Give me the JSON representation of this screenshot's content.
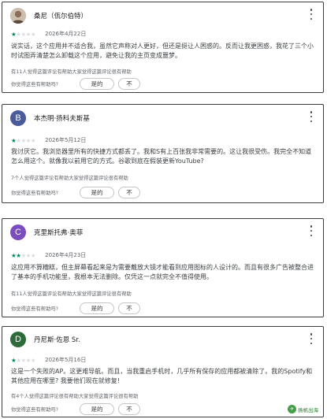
{
  "colors": {
    "star_filled": "#01875f",
    "star_empty": "#dadce0",
    "border": "#3c3c3c"
  },
  "reviews": [
    {
      "reviewer": "桑尼（佤尔伯特）",
      "avatar_icon": "profile-photo",
      "rating": 1,
      "max_rating": 5,
      "date": "2026年4月22日",
      "text": "说实话，这个应用并不适合我，虽然它声称对人更好，但还是挺让人困惑的。反而让我更困惑，我花了三个小时试图弄清楚怎么卸载这个应用，避免让我的主页变成噩梦。",
      "helpful_count": "有11人觉得这篇评论有帮助大家觉得这篇评论很有帮助",
      "helpful_question": "你觉得这些有帮助吗?",
      "yes_label": "是的",
      "no_label": "不"
    },
    {
      "reviewer": "本杰明·扬科夫斯基",
      "avatar_letter": "B",
      "avatar_color": "#4a5b9a",
      "rating": 1,
      "max_rating": 5,
      "date": "2026年5月12日",
      "text": "我讨厌它。我浏览器里所有的快捷方式都丢了。我和S有上百张我非常需要的。这让我很受伤。我完全不知道怎么用这个。就像我以前用它的方式。谷歌到底在假装更新YouTube?",
      "helpful_count": "7个人觉得这篇评论有帮助大家觉得这篇评论很有帮助",
      "helpful_question": "你觉得这些有帮助吗?",
      "yes_label": "是的",
      "no_label": "不"
    },
    {
      "reviewer": "克里斯托弗·奥菲",
      "avatar_letter": "C",
      "avatar_color": "#7c4dbf",
      "rating": 2,
      "max_rating": 5,
      "date": "2026年4月23日",
      "text": "这应用不算糟糕，但主屏幕看起来是为需要戴放大镜才能看到应用图标的人设计的。而且有很多广告被整合进了基本的手机功能里，我根本无法删除。仅凭这一点就完全不值得使用。",
      "helpful_count": "有11人觉得这篇评论有帮助大家觉得这篇评论很有帮助",
      "helpful_question": "你觉得这些有帮助吗?",
      "yes_label": "是的",
      "no_label": "不"
    },
    {
      "reviewer": "丹尼斯·佐恩 Sr.",
      "avatar_letter": "D",
      "avatar_color": "#2e6b3a",
      "rating": 1,
      "max_rating": 5,
      "date": "2026年5月16日",
      "text": "这是一个失败的AP。这更难导航。而且，当我重启手机时，几乎所有保存的应用都被清除了。我的Spotify和其他应用在哪里? 我要他们现在就修复!",
      "helpful_count": "有4个人觉得这篇评论很有帮助大家觉得这篇评论很有帮助",
      "helpful_question": "你觉得这些有帮助吗?",
      "yes_label": "是的",
      "no_label": "不"
    }
  ],
  "watermark": {
    "text": "扬帆出海"
  }
}
